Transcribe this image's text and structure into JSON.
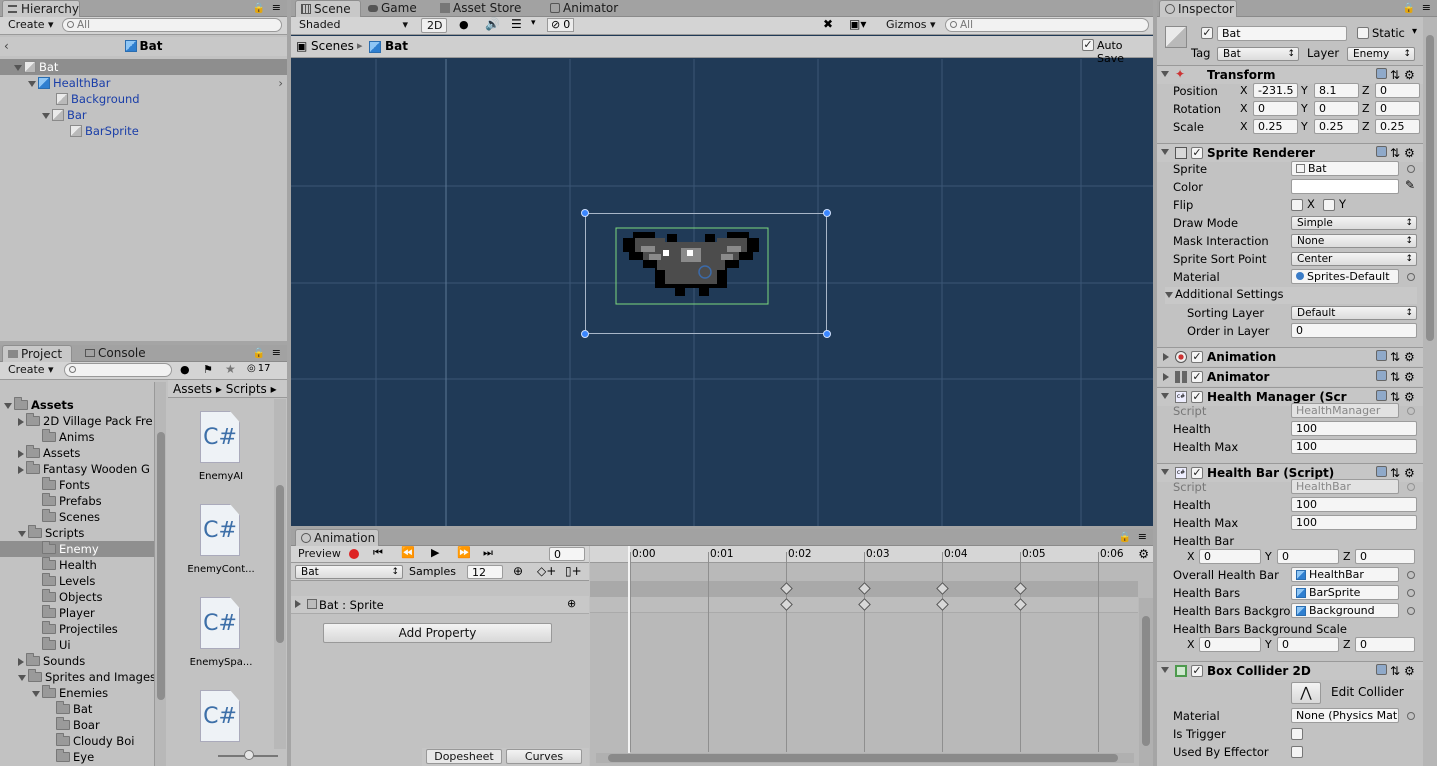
{
  "hierarchy": {
    "tab": "Hierarchy",
    "create_label": "Create",
    "search_placeholder": "All",
    "scene_name": "Bat",
    "items": [
      {
        "label": "Bat"
      },
      {
        "label": "HealthBar"
      },
      {
        "label": "Background"
      },
      {
        "label": "Bar"
      },
      {
        "label": "BarSprite"
      }
    ]
  },
  "scene": {
    "tabs": [
      "Scene",
      "Game",
      "Asset Store",
      "Animator"
    ],
    "shading": "Shaded",
    "mode_2d": "2D",
    "hidden_count": "0",
    "gizmos": "Gizmos",
    "search_placeholder": "All",
    "breadcrumb_scenes": "Scenes",
    "breadcrumb_object": "Bat",
    "auto_save": "Auto Save"
  },
  "animation": {
    "tab": "Animation",
    "preview": "Preview",
    "frame": "0",
    "clip": "Bat",
    "samples_label": "Samples",
    "samples_value": "12",
    "property": "Bat : Sprite",
    "add_property": "Add Property",
    "times": [
      "0:00",
      "0:01",
      "0:02",
      "0:03",
      "0:04",
      "0:05",
      "0:06"
    ],
    "dopesheet": "Dopesheet",
    "curves": "Curves"
  },
  "project": {
    "tabs": [
      "Project",
      "Console"
    ],
    "create_label": "Create",
    "badge_count": "17",
    "breadcrumb": [
      "Assets",
      "Scripts"
    ],
    "tree": [
      {
        "label": "Assets",
        "bold": true
      },
      {
        "label": "2D Village Pack Fre"
      },
      {
        "label": "Anims"
      },
      {
        "label": "Assets"
      },
      {
        "label": "Fantasy Wooden G"
      },
      {
        "label": "Fonts"
      },
      {
        "label": "Prefabs"
      },
      {
        "label": "Scenes"
      },
      {
        "label": "Scripts"
      },
      {
        "label": "Enemy"
      },
      {
        "label": "Health"
      },
      {
        "label": "Levels"
      },
      {
        "label": "Objects"
      },
      {
        "label": "Player"
      },
      {
        "label": "Projectiles"
      },
      {
        "label": "Ui"
      },
      {
        "label": "Sounds"
      },
      {
        "label": "Sprites and Images"
      },
      {
        "label": "Enemies"
      },
      {
        "label": "Bat"
      },
      {
        "label": "Boar"
      },
      {
        "label": "Cloudy Boi"
      },
      {
        "label": "Eye"
      }
    ],
    "files": [
      {
        "label": "EnemyAI"
      },
      {
        "label": "EnemyCont..."
      },
      {
        "label": "EnemySpa..."
      },
      {
        "label": ""
      }
    ],
    "file_icon_text": "C#"
  },
  "inspector": {
    "tab": "Inspector",
    "object_name": "Bat",
    "static_label": "Static",
    "tag_label": "Tag",
    "tag_value": "Bat",
    "layer_label": "Layer",
    "layer_value": "Enemy",
    "transform": {
      "title": "Transform",
      "position_label": "Position",
      "pos": [
        "-231.5",
        "8.1",
        "0"
      ],
      "rotation_label": "Rotation",
      "rot": [
        "0",
        "0",
        "0"
      ],
      "scale_label": "Scale",
      "scale": [
        "0.25",
        "0.25",
        "0.25"
      ]
    },
    "sprite_renderer": {
      "title": "Sprite Renderer",
      "sprite_label": "Sprite",
      "sprite_value": "Bat",
      "color_label": "Color",
      "flip_label": "Flip",
      "flip_x": "X",
      "flip_y": "Y",
      "draw_mode_label": "Draw Mode",
      "draw_mode": "Simple",
      "mask_label": "Mask Interaction",
      "mask": "None",
      "sort_point_label": "Sprite Sort Point",
      "sort_point": "Center",
      "material_label": "Material",
      "material": "Sprites-Default",
      "additional": "Additional Settings",
      "sorting_layer_label": "Sorting Layer",
      "sorting_layer": "Default",
      "order_label": "Order in Layer",
      "order": "0"
    },
    "animation_title": "Animation",
    "animator_title": "Animator",
    "health_manager": {
      "title": "Health Manager (Scri",
      "script_label": "Script",
      "script": "HealthManager",
      "health_label": "Health",
      "health": "100",
      "health_max_label": "Health Max",
      "health_max": "100"
    },
    "health_bar": {
      "title": "Health Bar (Script)",
      "script_label": "Script",
      "script": "HealthBar",
      "health_label": "Health",
      "health": "100",
      "health_max_label": "Health Max",
      "health_max": "100",
      "health_bar_label": "Health Bar",
      "hb": [
        "0",
        "0",
        "0"
      ],
      "overall_label": "Overall Health Bar",
      "overall": "HealthBar",
      "bars_label": "Health Bars",
      "bars": "BarSprite",
      "bg_label": "Health Bars Backgrou",
      "bg": "Background",
      "bg_scale_label": "Health Bars Background Scale",
      "bgs": [
        "0",
        "0",
        "0"
      ]
    },
    "box_collider": {
      "title": "Box Collider 2D",
      "edit_collider": "Edit Collider",
      "material_label": "Material",
      "material": "None (Physics Mat",
      "trigger_label": "Is Trigger",
      "effector_label": "Used By Effector"
    },
    "axis": [
      "X",
      "Y",
      "Z"
    ]
  }
}
